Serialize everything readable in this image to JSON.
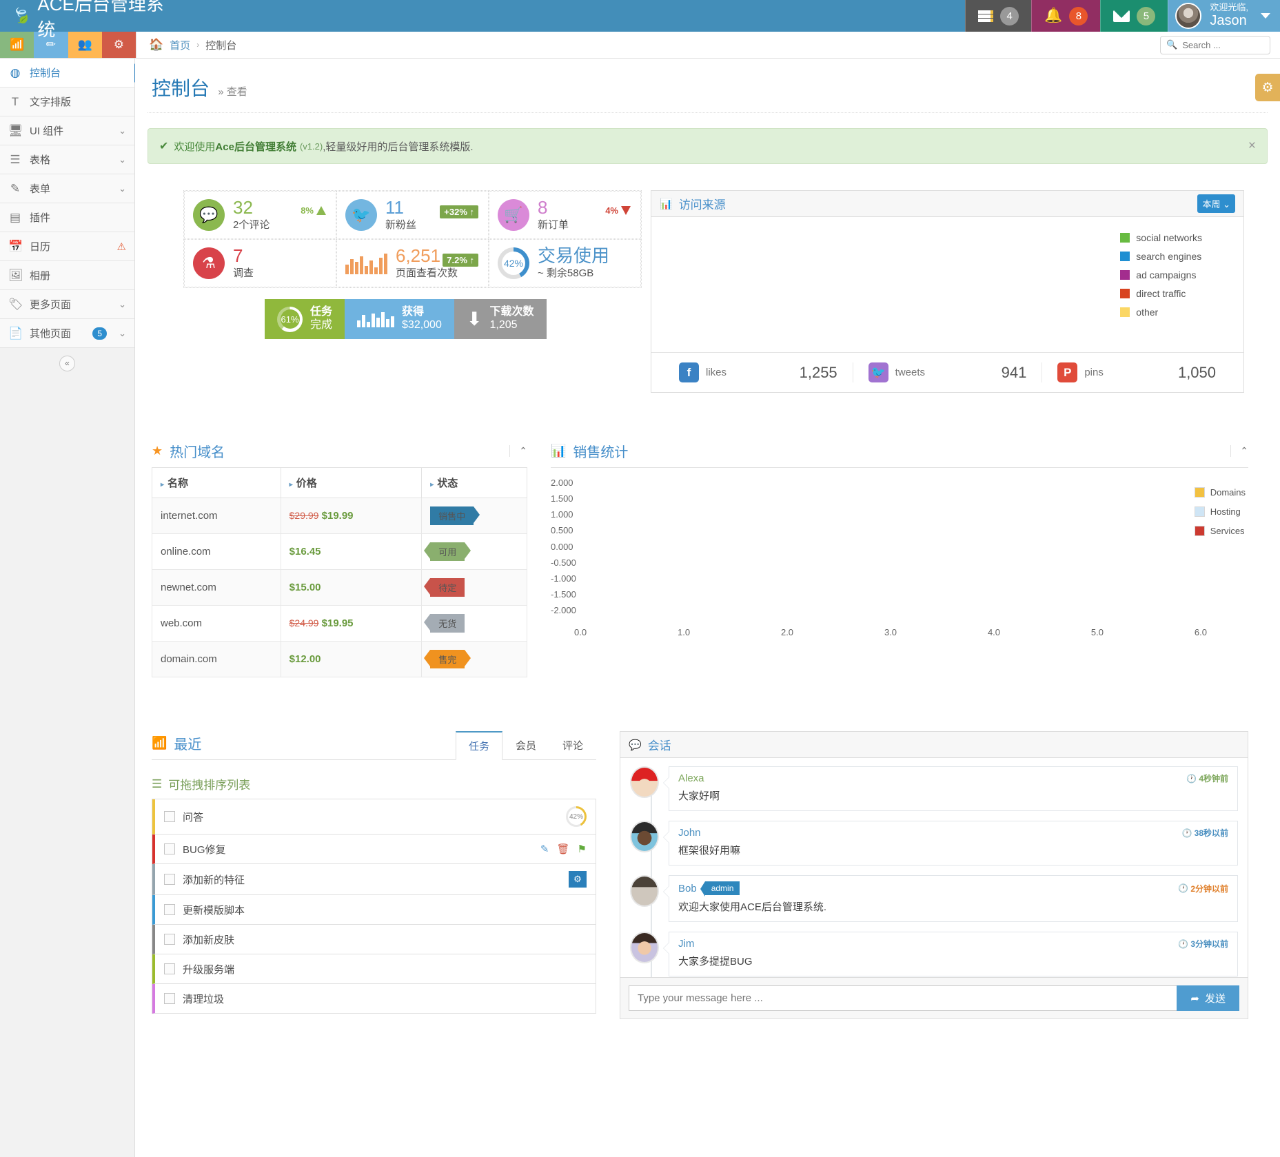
{
  "header": {
    "brand": "ACE后台管理系统",
    "tasks_badge": "4",
    "notif_badge": "8",
    "mail_badge": "5",
    "welcome": "欢迎光临,",
    "username": "Jason"
  },
  "subbar": {
    "breadcrumb_home": "首页",
    "breadcrumb_sep": "›",
    "breadcrumb_current": "控制台",
    "search_placeholder": "Search ..."
  },
  "sidebar": {
    "items": [
      {
        "label": "控制台",
        "icon": "dashboard-icon",
        "active": true
      },
      {
        "label": "文字排版",
        "icon": "typography-icon"
      },
      {
        "label": "UI 组件",
        "icon": "monitor-icon",
        "chevron": "⌄"
      },
      {
        "label": "表格",
        "icon": "list-icon",
        "chevron": "⌄"
      },
      {
        "label": "表单",
        "icon": "edit-icon",
        "chevron": "⌄"
      },
      {
        "label": "插件",
        "icon": "plugin-icon"
      },
      {
        "label": "日历",
        "icon": "calendar-icon",
        "warn": "⚠"
      },
      {
        "label": "相册",
        "icon": "image-icon"
      },
      {
        "label": "更多页面",
        "icon": "tag-icon",
        "chevron": "⌄"
      },
      {
        "label": "其他页面",
        "icon": "file-icon",
        "badge": "5",
        "chevron": "⌄"
      }
    ],
    "collapse": "«"
  },
  "page": {
    "title": "控制台",
    "subtitle": "» 查看"
  },
  "alert": {
    "check": "✔",
    "lead": "欢迎使用 ",
    "bold": "Ace后台管理系统",
    "version": "(v1.2)",
    "rest": ",轻量级好用的后台管理系统模版.",
    "close": "×"
  },
  "stats": [
    {
      "icon": "comment-icon",
      "color": "c-green",
      "value": "32",
      "value_class": "g-green",
      "label": "2个评论",
      "delta": "8%",
      "delta_style": "plain",
      "dir": "up"
    },
    {
      "icon": "twitter-icon",
      "color": "c-blue",
      "value": "11",
      "value_class": "g-blue",
      "label": "新粉丝",
      "delta": "+32% ↑",
      "delta_style": "boxed"
    },
    {
      "icon": "cart-icon",
      "color": "c-pink",
      "value": "8",
      "value_class": "g-pink",
      "label": "新订单",
      "delta": "4%",
      "delta_style": "plain",
      "dir": "down"
    },
    {
      "icon": "flask-icon",
      "color": "c-red",
      "value": "7",
      "value_class": "g-red",
      "label": "调查",
      "delta": "",
      "delta_style": "none"
    },
    {
      "icon": "bars-icon",
      "color": "bars",
      "value": "6,251",
      "value_class": "g-orange",
      "label": "页面查看次数",
      "delta": "7.2% ↑",
      "delta_style": "boxed"
    },
    {
      "icon": "donut-icon",
      "color": "donut",
      "donut_pct": "42%",
      "value": "交易使用",
      "value_class": "g-blue2",
      "label": "~ 剩余58GB",
      "delta": "",
      "delta_style": "none"
    }
  ],
  "tiles": [
    {
      "kind": "ring",
      "pct": "61%",
      "line1": "任务",
      "line2": "完成",
      "cls": "t-green"
    },
    {
      "kind": "bars",
      "line1": "获得",
      "line2": "$32,000",
      "cls": "t-blue"
    },
    {
      "kind": "download",
      "line1": "下载次数",
      "line2": "1,205",
      "cls": "t-grey"
    }
  ],
  "traffic": {
    "title": "访问来源",
    "icon": "bar-chart-icon",
    "select_value": "本周",
    "legend": [
      {
        "label": "social networks",
        "color": "#68bb41"
      },
      {
        "label": "search engines",
        "color": "#1f8fd2"
      },
      {
        "label": "ad campaigns",
        "color": "#a32d8e"
      },
      {
        "label": "direct traffic",
        "color": "#d8431f"
      },
      {
        "label": "other",
        "color": "#fbd765"
      }
    ],
    "social": [
      {
        "icon": "facebook-icon",
        "cls": "sq-fb",
        "glyph": "f",
        "label": "likes",
        "value": "1,255"
      },
      {
        "icon": "twitter-icon",
        "cls": "sq-tw",
        "glyph": "🐦",
        "label": "tweets",
        "value": "941"
      },
      {
        "icon": "pinterest-icon",
        "cls": "sq-pn",
        "glyph": "P",
        "label": "pins",
        "value": "1,050"
      }
    ]
  },
  "domains": {
    "title": "热门域名",
    "icon": "star-icon",
    "collapse": "⌃",
    "columns": [
      "名称",
      "价格",
      "状态"
    ],
    "rows": [
      {
        "name": "internet.com",
        "old": "$29.99",
        "price": "$19.99",
        "status": "销售中",
        "tag": "tag-blue",
        "shape": "arrow-r a-blue"
      },
      {
        "name": "online.com",
        "old": "",
        "price": "$16.45",
        "status": "可用",
        "tag": "tag-green",
        "shape": "arrow-l a-green arrow-r a-green2"
      },
      {
        "name": "newnet.com",
        "old": "",
        "price": "$15.00",
        "status": "待定",
        "tag": "tag-red",
        "shape": "arrow-l a-red"
      },
      {
        "name": "web.com",
        "old": "$24.99",
        "price": "$19.95",
        "status": "无货",
        "tag": "tag-grey",
        "shape": "arrow-l a-grey"
      },
      {
        "name": "domain.com",
        "old": "",
        "price": "$12.00",
        "status": "售完",
        "tag": "tag-orange",
        "shape": "arrow-l a-org arrow-r a-org"
      }
    ]
  },
  "chart_data": {
    "type": "line",
    "title": "销售统计",
    "icon": "bar-chart-icon",
    "collapse": "⌃",
    "xlabel": "",
    "ylabel": "",
    "xlim": [
      0.0,
      6.0
    ],
    "ylim": [
      -2.0,
      2.0
    ],
    "grid": false,
    "legend_position": "right",
    "x_ticks": [
      "0.0",
      "1.0",
      "2.0",
      "3.0",
      "4.0",
      "5.0",
      "6.0"
    ],
    "y_ticks": [
      "2.000",
      "1.500",
      "1.000",
      "0.500",
      "0.000",
      "-0.500",
      "-1.000",
      "-1.500",
      "-2.000"
    ],
    "series": [
      {
        "name": "Domains",
        "color": "#f2c141",
        "values": []
      },
      {
        "name": "Hosting",
        "color": "#cfe5f5",
        "values": []
      },
      {
        "name": "Services",
        "color": "#cc3a30",
        "values": []
      }
    ]
  },
  "recent": {
    "title": "最近",
    "icon": "rss-icon",
    "tabs": [
      {
        "label": "任务",
        "active": true
      },
      {
        "label": "会员",
        "active": false
      },
      {
        "label": "评论",
        "active": false
      }
    ],
    "list_title": "可拖拽排序列表",
    "list_icon": "reorder-icon",
    "items": [
      {
        "text": "问答",
        "accent": "#edc33c",
        "pct": "42%",
        "actions": []
      },
      {
        "text": "BUG修复",
        "accent": "#d7312c",
        "actions": [
          "edit-icon",
          "trash-icon",
          "flag-icon"
        ]
      },
      {
        "text": "添加新的特征",
        "accent": "#94a4ad",
        "actions": [
          "gear-icon"
        ]
      },
      {
        "text": "更新模版脚本",
        "accent": "#3a9ad4",
        "actions": []
      },
      {
        "text": "添加新皮肤",
        "accent": "#878787",
        "actions": []
      },
      {
        "text": "升级服务端",
        "accent": "#9bbb2c",
        "actions": []
      },
      {
        "text": "清理垃圾",
        "accent": "#d57ae0",
        "actions": []
      }
    ]
  },
  "chat": {
    "title": "会话",
    "icon": "comment-icon",
    "messages": [
      {
        "user": "Alexa",
        "name_cls": "green",
        "time": "4秒钟前",
        "time_cls": "ts-green",
        "body": "大家好啊",
        "avatar": "av1",
        "admin": false
      },
      {
        "user": "John",
        "name_cls": "",
        "time": "38秒以前",
        "time_cls": "ts-blue",
        "body": "框架很好用嘛",
        "avatar": "av2",
        "admin": false
      },
      {
        "user": "Bob",
        "name_cls": "",
        "time": "2分钟以前",
        "time_cls": "ts-orange",
        "body": "欢迎大家使用ACE后台管理系统.",
        "avatar": "av3",
        "admin": true,
        "admin_label": "admin"
      },
      {
        "user": "Jim",
        "name_cls": "",
        "time": "3分钟以前",
        "time_cls": "ts-blue",
        "body": "大家多提提BUG",
        "avatar": "av4",
        "admin": false
      }
    ],
    "input_placeholder": "Type your message here ...",
    "send_label": "发送",
    "send_icon": "send-icon"
  },
  "settings_tab_icon": "gear-icon"
}
